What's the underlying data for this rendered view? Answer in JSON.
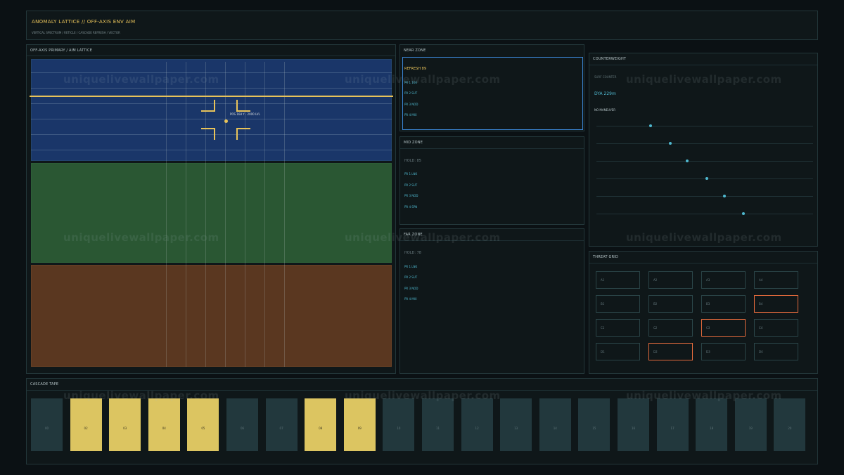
{
  "header": {
    "title": "ANOMALY LATTICE  //  OFF-AXIS ENV AIM",
    "breadcrumb": "VERTICAL SPECTRUM  /  RETICLE  /  CASCADE REFRESH  /  VECTOR"
  },
  "main": {
    "title": "OFF-AXIS PRIMARY  /  AIM LATTICE",
    "readout": "POS 168 Y  ·  2000 LVL",
    "colors": {
      "near": "#1a3669",
      "mid": "#2a5733",
      "far": "#5a3720",
      "accent": "#e8c35a"
    }
  },
  "zones": {
    "near": {
      "title": "NEAR ZONE",
      "status": "REFRESH 89",
      "items": [
        "PR 1 166",
        "PR 2 SUT",
        "PR 3 NOD",
        "PR 4 MIX"
      ]
    },
    "mid": {
      "title": "MID ZONE",
      "status": "HOLD: 85",
      "items": [
        "PR 1 LNK",
        "PR 2 SUT",
        "PR 3 NOD",
        "PR 4 SPN"
      ]
    },
    "far": {
      "title": "FAR ZONE",
      "status": "HOLD: 78",
      "items": [
        "PR 1 LNK",
        "PR 2 SUT",
        "PR 3 NOD",
        "PR 4 MIX"
      ]
    }
  },
  "counterweight": {
    "title": "COUNTERWEIGHT",
    "label": "SURF COUNTER",
    "value": "DYA 229m",
    "status": "NO MANEUVER",
    "dot_positions": [
      0.25,
      0.34,
      0.42,
      0.51,
      0.59,
      0.68
    ]
  },
  "threat": {
    "title": "THREAT GRID",
    "rows": [
      [
        {
          "id": "A1",
          "hot": false
        },
        {
          "id": "A2",
          "hot": false
        },
        {
          "id": "A3",
          "hot": false
        },
        {
          "id": "A4",
          "hot": false
        }
      ],
      [
        {
          "id": "B1",
          "hot": false
        },
        {
          "id": "B2",
          "hot": false
        },
        {
          "id": "B3",
          "hot": false
        },
        {
          "id": "B4",
          "hot": true
        }
      ],
      [
        {
          "id": "C1",
          "hot": false
        },
        {
          "id": "C2",
          "hot": false
        },
        {
          "id": "C3",
          "hot": true
        },
        {
          "id": "C4",
          "hot": false
        }
      ],
      [
        {
          "id": "D1",
          "hot": false
        },
        {
          "id": "D2",
          "hot": true
        },
        {
          "id": "D3",
          "hot": false
        },
        {
          "id": "D4",
          "hot": false
        }
      ]
    ]
  },
  "cascade": {
    "title": "CASCADE TAPE",
    "tiles": [
      {
        "label": "00",
        "on": false
      },
      {
        "label": "02",
        "on": true
      },
      {
        "label": "03",
        "on": true
      },
      {
        "label": "04",
        "on": true
      },
      {
        "label": "05",
        "on": true
      },
      {
        "label": "06",
        "on": false
      },
      {
        "label": "07",
        "on": false
      },
      {
        "label": "08",
        "on": true
      },
      {
        "label": "09",
        "on": true
      },
      {
        "label": "10",
        "on": false
      },
      {
        "label": "11",
        "on": false
      },
      {
        "label": "12",
        "on": false
      },
      {
        "label": "13",
        "on": false
      },
      {
        "label": "14",
        "on": false
      },
      {
        "label": "15",
        "on": false
      },
      {
        "label": "16",
        "on": false
      },
      {
        "label": "17",
        "on": false
      },
      {
        "label": "18",
        "on": false
      },
      {
        "label": "19",
        "on": false
      },
      {
        "label": "20",
        "on": false
      }
    ]
  },
  "watermark": "uniquelivewallpaper.com"
}
